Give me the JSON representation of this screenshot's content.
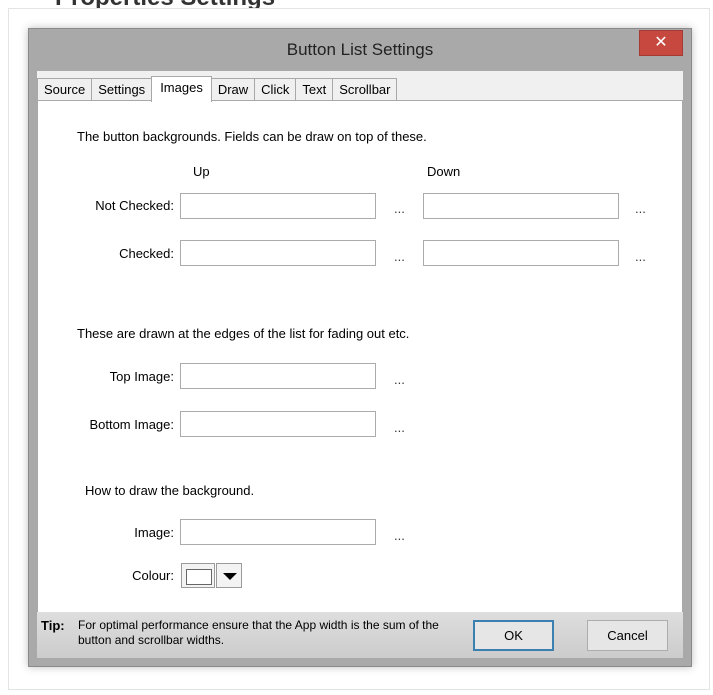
{
  "page": {
    "heading": "Properties Settings"
  },
  "dialog": {
    "title": "Button List Settings",
    "close_glyph": "✕",
    "tabs": [
      {
        "label": "Source"
      },
      {
        "label": "Settings"
      },
      {
        "label": "Images",
        "active": true
      },
      {
        "label": "Draw"
      },
      {
        "label": "Click"
      },
      {
        "label": "Text"
      },
      {
        "label": "Scrollbar"
      }
    ],
    "images_tab": {
      "intro": "The button backgrounds. Fields can be draw on top of these.",
      "col_up": "Up",
      "col_down": "Down",
      "rows": [
        {
          "label": "Not Checked:",
          "up_value": "",
          "down_value": ""
        },
        {
          "label": "Checked:",
          "up_value": "",
          "down_value": ""
        }
      ],
      "ellipsis": "...",
      "edges_intro": "These are drawn at the edges of the list for fading out etc.",
      "top_image_label": "Top Image:",
      "top_image_value": "",
      "bottom_image_label": "Bottom Image:",
      "bottom_image_value": "",
      "bg_intro": "How to draw the background.",
      "image_label": "Image:",
      "image_value": "",
      "colour_label": "Colour:",
      "colour_value": "#ffffff"
    },
    "footer": {
      "tip_label": "Tip:",
      "tip_text": "For optimal performance ensure that the App width is the sum of the button and scrollbar widths.",
      "ok_label": "OK",
      "cancel_label": "Cancel"
    }
  },
  "colors": {
    "accent": "#3c7fb1",
    "close": "#c7483f"
  },
  "icons": {
    "close": "close-icon",
    "dropdown": "chevron-down-icon"
  }
}
